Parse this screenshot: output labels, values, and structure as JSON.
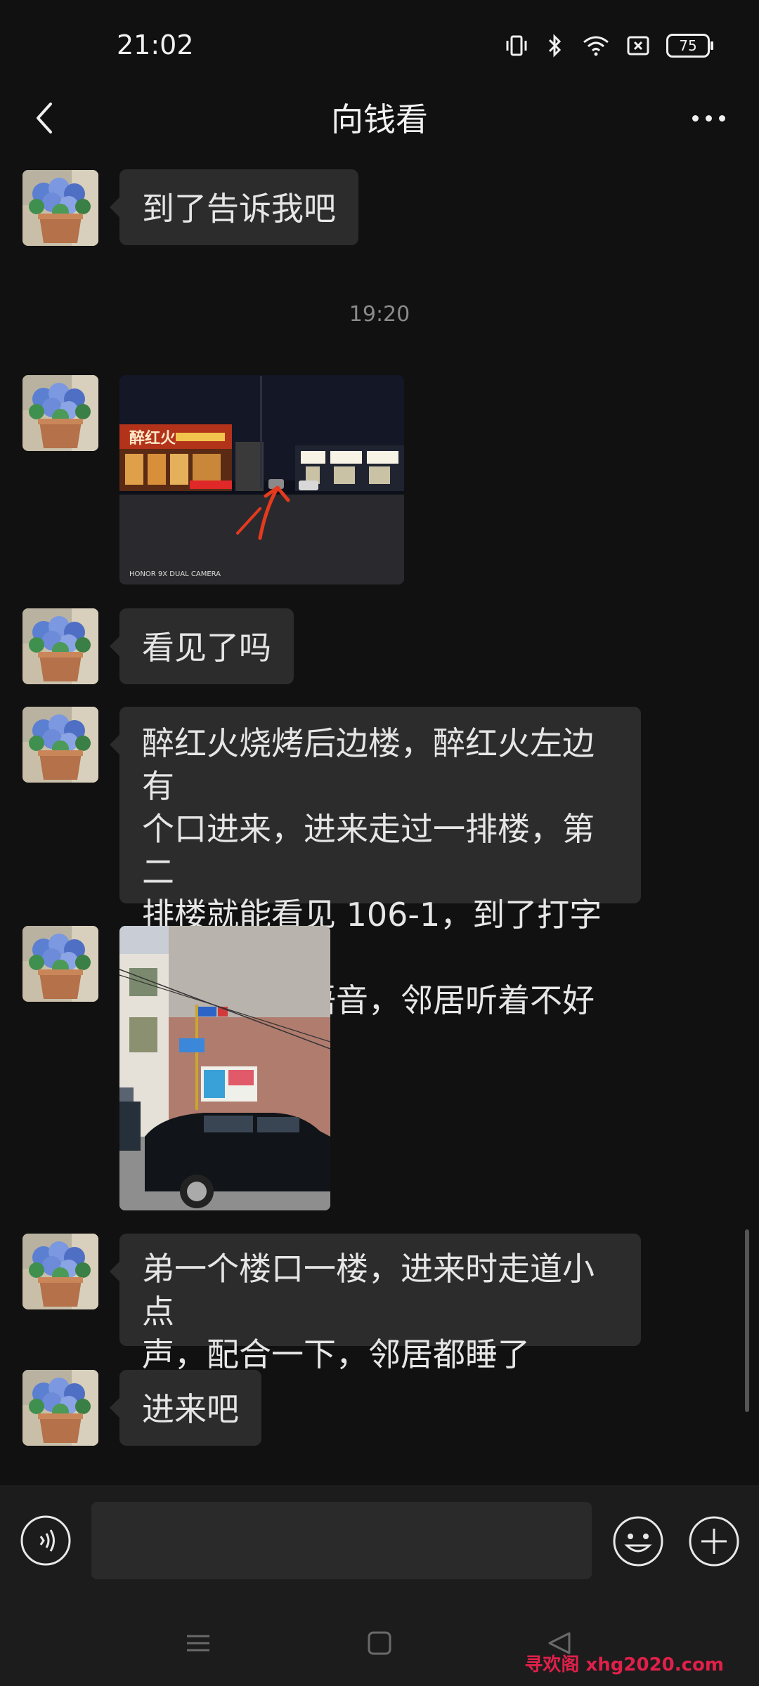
{
  "status_bar": {
    "time": "21:02",
    "battery": "75",
    "icons": [
      "vibrate-icon",
      "bluetooth-icon",
      "wifi-icon",
      "sim-icon",
      "battery-icon"
    ]
  },
  "header": {
    "title": "向钱看",
    "back_icon": "back-arrow-icon",
    "more_icon": "more-icon"
  },
  "messages": [
    {
      "type": "text",
      "text": "到了告诉我吧"
    },
    {
      "type": "timestamp",
      "text": "19:20"
    },
    {
      "type": "image",
      "content": "night street photo with red arrow",
      "watermark": "HONOR 9X DUAL CAMERA",
      "sign": "醉红火"
    },
    {
      "type": "text",
      "text": "看见了吗"
    },
    {
      "type": "text",
      "lines": [
        "醉红火烧烤后边楼，醉红火左边有",
        "个口进来，进来走过一排楼，第二",
        "排楼就能看见 106-1，到了打字告",
        "诉我，别发语音，邻居听着不好"
      ]
    },
    {
      "type": "image",
      "content": "building entrance with parked black car"
    },
    {
      "type": "text",
      "lines": [
        "弟一个楼口一楼，进来时走道小点",
        "声，配合一下，邻居都睡了"
      ]
    },
    {
      "type": "text",
      "text": "进来吧"
    }
  ],
  "input_bar": {
    "placeholder": "",
    "voice_icon": "voice-icon",
    "emoji_icon": "emoji-icon",
    "plus_icon": "plus-icon"
  },
  "nav_bar": {
    "icons": [
      "menu-icon",
      "home-icon",
      "back-icon"
    ]
  },
  "watermark": {
    "part1": "寻欢阁",
    "part2": "xhg2020.com"
  },
  "colors": {
    "background": "#111111",
    "bubble": "#2c2c2c",
    "text": "#e6e6e6",
    "timestamp": "#8a8a8a",
    "watermark": "#e0204a"
  }
}
